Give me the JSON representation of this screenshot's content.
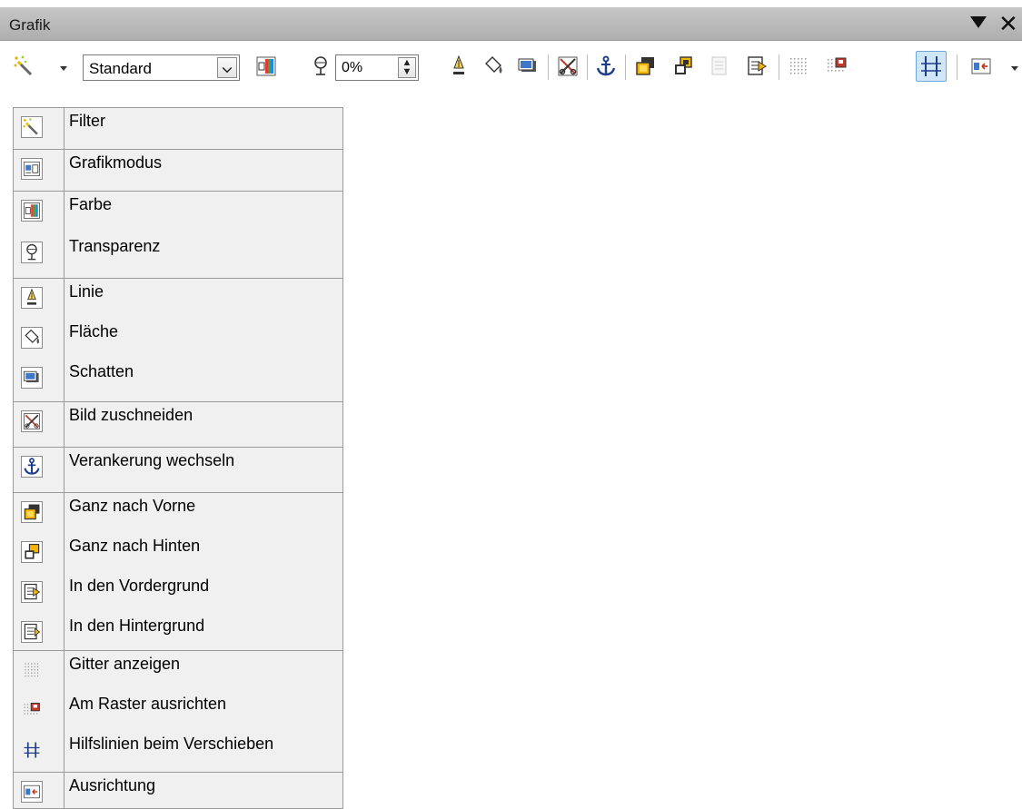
{
  "window": {
    "title": "Grafik"
  },
  "toolbar": {
    "style_select": {
      "value": "Standard"
    },
    "transparency": {
      "value": "0%"
    },
    "icons": [
      "filter-icon",
      "color-icon",
      "transparency-icon",
      "line-icon",
      "area-icon",
      "shadow-icon",
      "crop-icon",
      "anchor-icon",
      "bring-to-front-icon",
      "send-to-back-icon",
      "bring-forward-icon",
      "send-backward-icon",
      "display-grid-icon",
      "snap-to-grid-icon",
      "helplines-icon",
      "alignment-icon"
    ]
  },
  "reference": {
    "rows": [
      {
        "label": "Filter",
        "icon": "filter-icon",
        "group_start": true
      },
      {
        "label": "Grafikmodus",
        "icon": "graphics-mode-icon",
        "group_start": true
      },
      {
        "label": "Farbe",
        "icon": "color-icon",
        "group_start": true
      },
      {
        "label": "Transparenz",
        "icon": "transparency-icon",
        "group_start": false
      },
      {
        "label": "Linie",
        "icon": "line-icon",
        "group_start": true
      },
      {
        "label": "Fläche",
        "icon": "area-icon",
        "group_start": false
      },
      {
        "label": "Schatten",
        "icon": "shadow-icon",
        "group_start": false
      },
      {
        "label": "Bild zuschneiden",
        "icon": "crop-icon",
        "group_start": true
      },
      {
        "label": "Verankerung wechseln",
        "icon": "anchor-icon",
        "group_start": true
      },
      {
        "label": "Ganz nach Vorne",
        "icon": "bring-to-front-icon",
        "group_start": true
      },
      {
        "label": "Ganz nach Hinten",
        "icon": "send-to-back-icon",
        "group_start": false
      },
      {
        "label": "In den Vordergrund",
        "icon": "bring-forward-icon",
        "group_start": false
      },
      {
        "label": "In den Hintergrund",
        "icon": "send-backward-icon",
        "group_start": false
      },
      {
        "label": "Gitter anzeigen",
        "icon": "display-grid-icon",
        "group_start": true
      },
      {
        "label": "Am Raster ausrichten",
        "icon": "snap-to-grid-icon",
        "group_start": false
      },
      {
        "label": "Hilfslinien beim Verschieben",
        "icon": "helplines-icon",
        "group_start": false
      },
      {
        "label": "Ausrichtung",
        "icon": "alignment-icon",
        "group_start": true
      }
    ]
  },
  "colors": {
    "titlebar": "#b8b8b8",
    "table_bg": "#f0f0f0",
    "active_button": "#cfe6f8"
  }
}
